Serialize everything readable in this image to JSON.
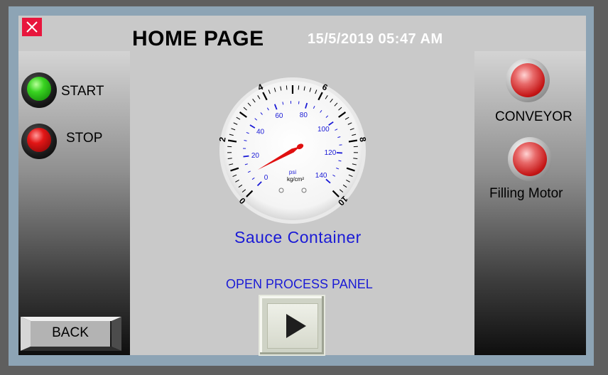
{
  "header": {
    "title": "HOME PAGE",
    "datetime": "15/5/2019 05:47 AM"
  },
  "left_panel": {
    "start_label": "START",
    "stop_label": "STOP",
    "back_label": "BACK"
  },
  "right_panel": {
    "conveyor_label": "CONVEYOR",
    "filling_motor_label": "Filling Motor"
  },
  "gauge": {
    "label": "Sauce Container",
    "outer_ticks": [
      "0",
      "2",
      "4",
      "6",
      "8",
      "10"
    ],
    "inner_ticks": [
      "0",
      "20",
      "40",
      "60",
      "80",
      "100",
      "120",
      "140"
    ],
    "unit_psi": "psi",
    "unit_kg": "kg/cm²",
    "reading_kgcm2": 0.6
  },
  "process": {
    "label": "OPEN PROCESS PANEL"
  },
  "icons": {
    "close": "close-icon",
    "play": "play-icon"
  },
  "colors": {
    "accent_blue": "#1a1ad6",
    "close_red": "#e8163d",
    "start_green": "#39d421",
    "stop_red": "#e31616"
  }
}
